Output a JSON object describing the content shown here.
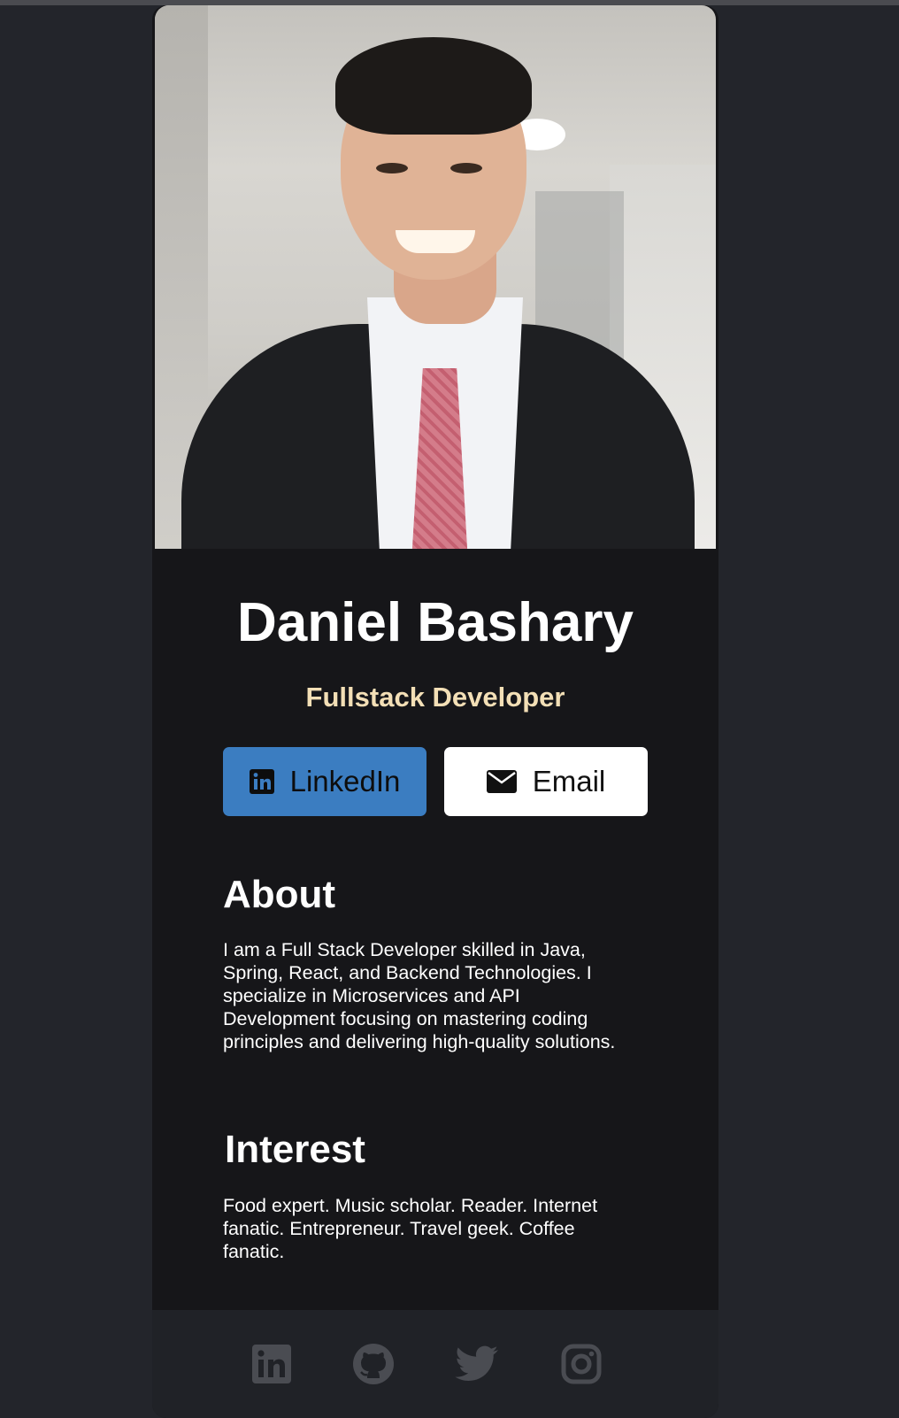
{
  "profile": {
    "name": "Daniel Bashary",
    "title": "Fullstack Developer",
    "photo_alt": "Profile photo"
  },
  "buttons": {
    "linkedin_label": "LinkedIn",
    "email_label": "Email"
  },
  "about": {
    "heading": "About",
    "text": "I am a Full Stack Developer skilled in Java, Spring, React, and Backend Technologies. I specialize in Microservices and API Development focusing on mastering coding principles and delivering high-quality solutions."
  },
  "interest": {
    "heading": "Interest",
    "text": "Food expert. Music scholar. Reader. Internet fanatic. Entrepreneur. Travel geek. Coffee fanatic."
  },
  "footer": {
    "icons": [
      "linkedin-icon",
      "github-icon",
      "twitter-icon",
      "instagram-icon"
    ]
  },
  "colors": {
    "page_background": "#23252b",
    "card_background": "#161619",
    "footer_background": "#202227",
    "title_accent": "#f3dfb6",
    "linkedin_button": "#3b7dc1",
    "email_button": "#ffffff",
    "footer_icon": "#4a4c52"
  }
}
